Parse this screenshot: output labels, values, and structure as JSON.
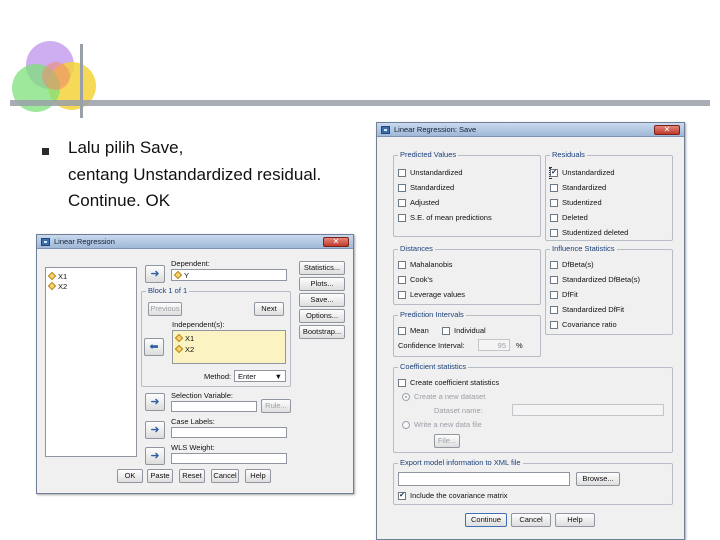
{
  "slide": {
    "bullet_line1": "Lalu pilih Save,",
    "bullet_line2": "centang Unstandardized residual.",
    "bullet_line3": "Continue. OK"
  },
  "regression_dialog": {
    "title": "Linear Regression",
    "variables": [
      "X1",
      "X2"
    ],
    "dependent_label": "Dependent:",
    "dependent_value": "Y",
    "block_label": "Block 1 of 1",
    "previous_button": "Previous",
    "next_button": "Next",
    "independent_label": "Independent(s):",
    "independent_values": [
      "X1",
      "X2"
    ],
    "method_label": "Method:",
    "method_value": "Enter",
    "selection_variable_label": "Selection Variable:",
    "rule_button": "Rule...",
    "case_labels_label": "Case Labels:",
    "wls_weight_label": "WLS Weight:",
    "side_buttons": [
      "Statistics...",
      "Plots...",
      "Save...",
      "Options...",
      "Bootstrap..."
    ],
    "bottom_buttons": [
      "OK",
      "Paste",
      "Reset",
      "Cancel",
      "Help"
    ]
  },
  "save_dialog": {
    "title": "Linear Regression: Save",
    "predicted_values": {
      "label": "Predicted Values",
      "options": [
        {
          "label": "Unstandardized",
          "checked": false
        },
        {
          "label": "Standardized",
          "checked": false
        },
        {
          "label": "Adjusted",
          "checked": false
        },
        {
          "label": "S.E. of mean predictions",
          "checked": false
        }
      ]
    },
    "residuals": {
      "label": "Residuals",
      "options": [
        {
          "label": "Unstandardized",
          "checked": true
        },
        {
          "label": "Standardized",
          "checked": false
        },
        {
          "label": "Studentized",
          "checked": false
        },
        {
          "label": "Deleted",
          "checked": false
        },
        {
          "label": "Studentized deleted",
          "checked": false
        }
      ]
    },
    "distances": {
      "label": "Distances",
      "options": [
        {
          "label": "Mahalanobis",
          "checked": false
        },
        {
          "label": "Cook's",
          "checked": false
        },
        {
          "label": "Leverage values",
          "checked": false
        }
      ]
    },
    "influence_statistics": {
      "label": "Influence Statistics",
      "options": [
        {
          "label": "DfBeta(s)",
          "checked": false
        },
        {
          "label": "Standardized DfBeta(s)",
          "checked": false
        },
        {
          "label": "DfFit",
          "checked": false
        },
        {
          "label": "Standardized DfFit",
          "checked": false
        },
        {
          "label": "Covariance ratio",
          "checked": false
        }
      ]
    },
    "prediction_intervals": {
      "label": "Prediction Intervals",
      "mean_label": "Mean",
      "individual_label": "Individual",
      "confidence_label": "Confidence Interval:",
      "confidence_value": "95",
      "percent_sign": "%"
    },
    "coefficient_statistics": {
      "label": "Coefficient statistics",
      "create_label": "Create coefficient statistics",
      "new_dataset_label": "Create a new dataset",
      "dataset_name_label": "Dataset name:",
      "write_file_label": "Write a new data file",
      "file_button": "File..."
    },
    "export": {
      "label": "Export model information to XML file",
      "browse_button": "Browse...",
      "include_covariance_label": "Include the covariance matrix",
      "include_covariance_checked": true
    },
    "buttons": {
      "continue": "Continue",
      "cancel": "Cancel",
      "help": "Help"
    }
  }
}
